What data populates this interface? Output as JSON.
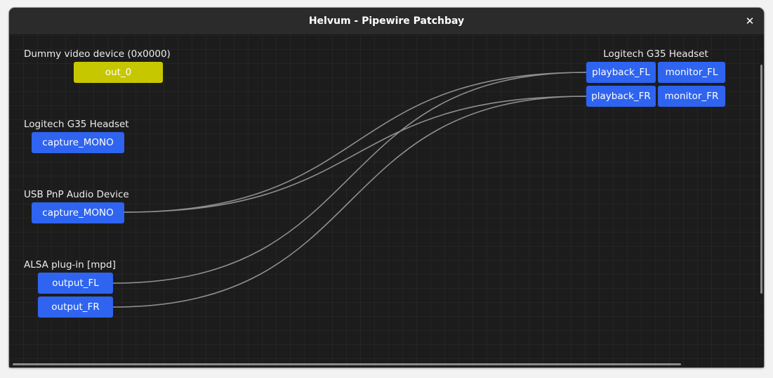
{
  "window": {
    "title": "Helvum - Pipewire Patchbay",
    "close_glyph": "✕"
  },
  "colors": {
    "audio_port": "#2f64f0",
    "video_port": "#c7c700",
    "link": "#8e8e8e"
  },
  "nodes": {
    "dummy_video": {
      "name": "Dummy video device (0x0000)",
      "ports": {
        "out_0": "out_0"
      }
    },
    "g35_capture": {
      "name": "Logitech G35 Headset",
      "ports": {
        "capture_mono": "capture_MONO"
      }
    },
    "usb_pnp": {
      "name": "USB PnP Audio Device",
      "ports": {
        "capture_mono": "capture_MONO"
      }
    },
    "alsa_mpd": {
      "name": "ALSA plug-in [mpd]",
      "ports": {
        "output_fl": "output_FL",
        "output_fr": "output_FR"
      }
    },
    "g35_playback": {
      "name": "Logitech G35 Headset",
      "ports": {
        "playback_fl": "playback_FL",
        "monitor_fl": "monitor_FL",
        "playback_fr": "playback_FR",
        "monitor_fr": "monitor_FR"
      }
    }
  },
  "links": [
    {
      "from": "usb_pnp.capture_mono",
      "to": "g35_playback.playback_fl"
    },
    {
      "from": "usb_pnp.capture_mono",
      "to": "g35_playback.playback_fr"
    },
    {
      "from": "alsa_mpd.output_fl",
      "to": "g35_playback.playback_fl"
    },
    {
      "from": "alsa_mpd.output_fr",
      "to": "g35_playback.playback_fr"
    }
  ]
}
